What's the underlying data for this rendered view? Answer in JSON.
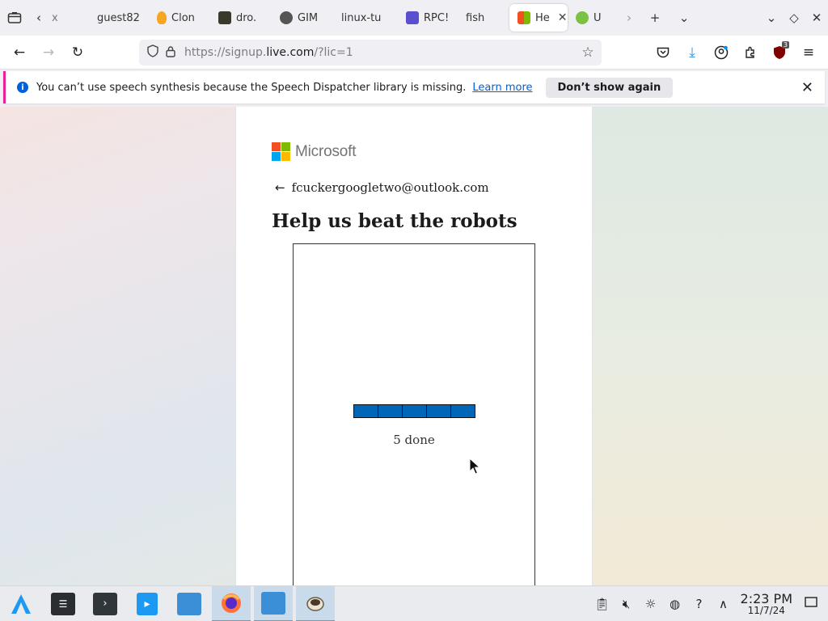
{
  "tabs": [
    {
      "label": "x",
      "favicon_color": "#9a9a9a",
      "active": false
    },
    {
      "label": "guest82",
      "favicon_color": "",
      "active": false
    },
    {
      "label": "Clon",
      "favicon_color": "#f5a623",
      "active": false
    },
    {
      "label": "dro.",
      "favicon_color": "#3a3a2a",
      "active": false
    },
    {
      "label": "GIM",
      "favicon_color": "#444444",
      "active": false
    },
    {
      "label": "linux-tu",
      "favicon_color": "",
      "active": false
    },
    {
      "label": "RPC!",
      "favicon_color": "#5a4fcf",
      "active": false
    },
    {
      "label": "fish",
      "favicon_color": "",
      "active": false
    },
    {
      "label": "He",
      "favicon_color": "#0067b8",
      "active": true
    },
    {
      "label": "U",
      "favicon_color": "#7cc242",
      "active": false
    }
  ],
  "tabbar": {
    "list_all_icon": "tab-overview-icon",
    "scroll_left": "chevron-left-icon",
    "scroll_right": "chevron-right-icon",
    "new_tab": "plus-icon",
    "list_tabs": "chevron-down-icon"
  },
  "window_controls": {
    "minimize": "chevron-down-icon",
    "maximize": "diamond-icon",
    "close": "close-icon"
  },
  "navbar": {
    "url_prefix": "https://signup.",
    "url_domain": "live.com",
    "url_suffix": "/?lic=1",
    "extension_badge": "3"
  },
  "notification": {
    "message": "You can’t use speech synthesis because the Speech Dispatcher library is missing.",
    "link": "Learn more",
    "button": "Don’t show again"
  },
  "page": {
    "brand": "Microsoft",
    "brand_colors": [
      "#f25022",
      "#7fba00",
      "#00a4ef",
      "#ffb900"
    ],
    "email": "fcuckergoogletwo@outlook.com",
    "heading": "Help us beat the robots",
    "progress_segments_done": 5,
    "progress_segments_total": 5,
    "progress_color": "#0067b8",
    "done_text": "5 done"
  },
  "taskbar": {
    "apps": [
      {
        "name": "app-launcher",
        "color": "#1d99f3",
        "active": false
      },
      {
        "name": "system-settings",
        "color": "#2a2e32",
        "active": false
      },
      {
        "name": "terminal",
        "color": "#31363b",
        "active": false
      },
      {
        "name": "discover-store",
        "color": "#1d99f3",
        "active": false
      },
      {
        "name": "file-manager",
        "color": "#3a8fd6",
        "active": false
      },
      {
        "name": "firefox",
        "color": "#ff7139",
        "active": true
      },
      {
        "name": "file-manager-2",
        "color": "#3a8fd6",
        "active": true
      },
      {
        "name": "coffee-app",
        "color": "#6d5b45",
        "active": true
      }
    ],
    "time": "2:23 PM",
    "date": "11/7/24"
  }
}
